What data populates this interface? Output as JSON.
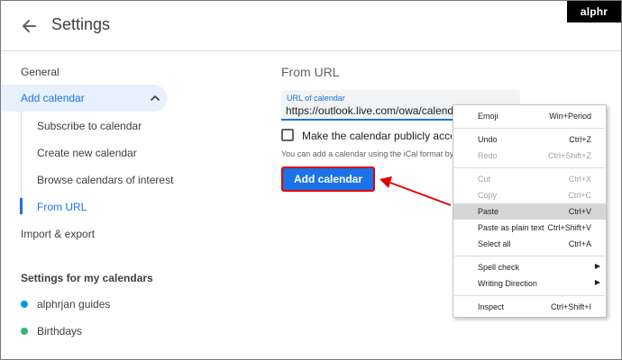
{
  "brand": "alphr",
  "header": {
    "title": "Settings"
  },
  "sidebar": {
    "general": "General",
    "add_calendar": "Add calendar",
    "sub_items": [
      {
        "label": "Subscribe to calendar"
      },
      {
        "label": "Create new calendar"
      },
      {
        "label": "Browse calendars of interest"
      },
      {
        "label": "From URL",
        "selected": true
      }
    ],
    "import_export": "Import & export",
    "section_title": "Settings for my calendars",
    "calendars": [
      {
        "label": "alphrjan guides",
        "color": "#039be5"
      },
      {
        "label": "Birthdays",
        "color": "#33b679"
      }
    ]
  },
  "main": {
    "title": "From URL",
    "url_label": "URL of calendar",
    "url_value": "https://outlook.live.com/owa/calendar/",
    "checkbox_label": "Make the calendar publicly accessible",
    "checkbox_checked": false,
    "hint": "You can add a calendar using the iCal format by",
    "add_button": "Add calendar"
  },
  "context_menu": {
    "items": [
      {
        "label": "Emoji",
        "shortcut": "Win+Period",
        "state": "enabled"
      },
      {
        "label": "Undo",
        "shortcut": "Ctrl+Z",
        "state": "enabled"
      },
      {
        "label": "Redo",
        "shortcut": "Ctrl+Shift+Z",
        "state": "disabled"
      },
      {
        "label": "Cut",
        "shortcut": "Ctrl+X",
        "state": "disabled"
      },
      {
        "label": "Copy",
        "shortcut": "Ctrl+C",
        "state": "disabled"
      },
      {
        "label": "Paste",
        "shortcut": "Ctrl+V",
        "state": "highlighted"
      },
      {
        "label": "Paste as plain text",
        "shortcut": "Ctrl+Shift+V",
        "state": "enabled"
      },
      {
        "label": "Select all",
        "shortcut": "Ctrl+A",
        "state": "enabled"
      },
      {
        "label": "Spell check",
        "shortcut": "",
        "state": "enabled",
        "submenu": true
      },
      {
        "label": "Writing Direction",
        "shortcut": "",
        "state": "enabled",
        "submenu": true
      },
      {
        "label": "Inspect",
        "shortcut": "Ctrl+Shift+I",
        "state": "enabled"
      }
    ]
  },
  "colors": {
    "accent": "#1a73e8",
    "accent_bg": "#e8f0fe",
    "highlight_border": "#e00000",
    "menu_highlight": "#d6d6d6"
  },
  "icons": {
    "back": "arrow-left-icon",
    "collapse": "chevron-up-icon",
    "submenu": "triangle-right-icon"
  }
}
